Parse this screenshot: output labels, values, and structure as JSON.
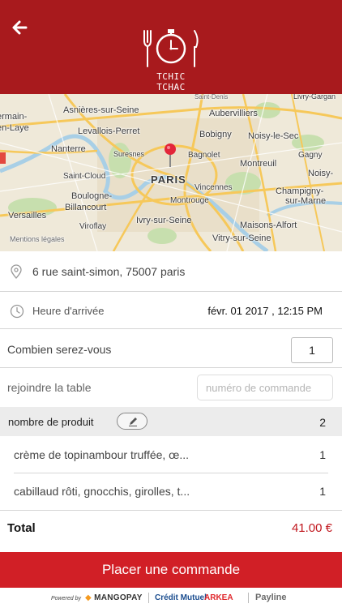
{
  "header": {
    "back_icon": "arrow-left-icon",
    "logo_text": "TCHIC TCHAC",
    "color": "#a81a1d"
  },
  "map": {
    "labels": {
      "asnieres": "Asnières-sur-Seine",
      "aubervilliers": "Aubervilliers",
      "saint_denis": "Saint-Denis",
      "levallois": "Levallois-Perret",
      "bobigny": "Bobigny",
      "noisy_le_sec": "Noisy-le-Sec",
      "nanterre": "Nanterre",
      "suresnes": "Suresnes",
      "bagnolet": "Bagnolet",
      "gagny": "Gagny",
      "montreuil": "Montreuil",
      "noisy": "Noisy-",
      "paris": "PARIS",
      "saint_cloud": "Saint-Cloud",
      "vincennes": "Vincennes",
      "champigny": "Champigny-",
      "sur_marne": "sur-Marne",
      "boulogne": "Boulogne-",
      "billancourt": "Billancourt",
      "montrouge": "Montrouge",
      "versailles": "Versailles",
      "ivry": "Ivry-sur-Seine",
      "maisons_alfort": "Maisons-Alfort",
      "viroflay": "Viroflay",
      "vitry": "Vitry-sur-Seine",
      "mentions": "Mentions légales",
      "germain": "ermain-",
      "laye": "en-Laye",
      "livry": "Livry-Gargan"
    }
  },
  "address": {
    "icon": "location-pin-icon",
    "text": "6 rue saint-simon, 75007 paris"
  },
  "arrival": {
    "icon": "clock-icon",
    "label": "Heure d'arrivée",
    "value": "févr. 01 2017 , 12:15 PM"
  },
  "guests": {
    "label": "Combien serez-vous",
    "value": "1"
  },
  "join": {
    "label": "rejoindre la table",
    "placeholder": "numéro de commande"
  },
  "products": {
    "label": "nombre de produit",
    "edit_icon": "pencil-icon",
    "count": "2",
    "items": [
      {
        "name": "crème de topinambour truffée, œ...",
        "qty": "1"
      },
      {
        "name": "cabillaud rôti, gnocchis, girolles, t...",
        "qty": "1"
      }
    ]
  },
  "total": {
    "label": "Total",
    "value": "41.00 €"
  },
  "order_button": {
    "label": "Placer une commande",
    "color": "#d11f26"
  },
  "footer": {
    "powered": "Powered by",
    "mangopay": "MANGOPAY",
    "credit_mutuel": "Crédit Mutuel",
    "arkea": "ARKEA",
    "payline": "Payline"
  }
}
